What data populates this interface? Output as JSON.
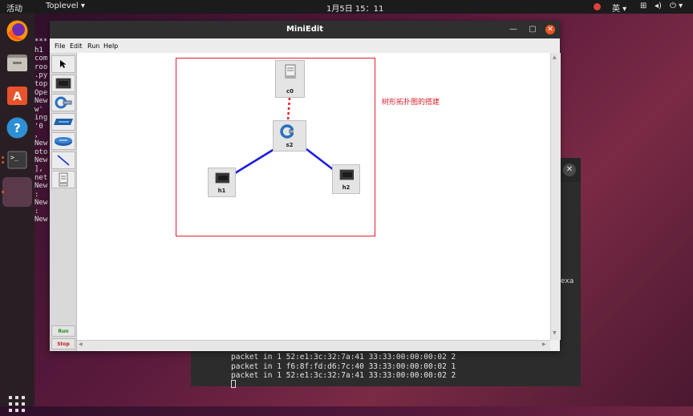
{
  "topbar": {
    "activities": "活动",
    "app_menu": "Toplevel",
    "clock": "1月5日  15：11",
    "input_method": "英"
  },
  "dock": {
    "icons": [
      "firefox-icon",
      "files-icon",
      "software-icon",
      "help-icon",
      "terminal-icon",
      "blank-app-icon",
      "show-apps-icon"
    ]
  },
  "window": {
    "title": "MiniEdit",
    "menus": [
      "File",
      "Edit",
      "Run",
      "Help"
    ],
    "run_label": "Run",
    "stop_label": "Stop"
  },
  "topology": {
    "nodes": {
      "controller": "c0",
      "switch": "s2",
      "host1": "h1",
      "host2": "h2"
    },
    "annotation": "树形拓扑图的搭建"
  },
  "terminal_left": {
    "lines": [
      "***",
      "h1",
      "com",
      "roo",
      ".py",
      "top",
      "Ope",
      "New",
      "w'",
      "ing",
      "'0",
      "，",
      "New",
      "oto",
      "New",
      "],",
      "net",
      "New",
      ":",
      "New",
      ":",
      "New"
    ]
  },
  "terminal_bottom": {
    "lines": [
      "packet in 1 52:e1:3c:32:7a:41 33:33:00:00:00:02 2",
      "packet in 1 f6:8f:fd:d6:7c:40 33:33:00:00:00:02 1",
      "packet in 1 52:e1:3c:32:7a:41 33:33:00:00:00:02 2"
    ],
    "right_fragment": "exa"
  }
}
